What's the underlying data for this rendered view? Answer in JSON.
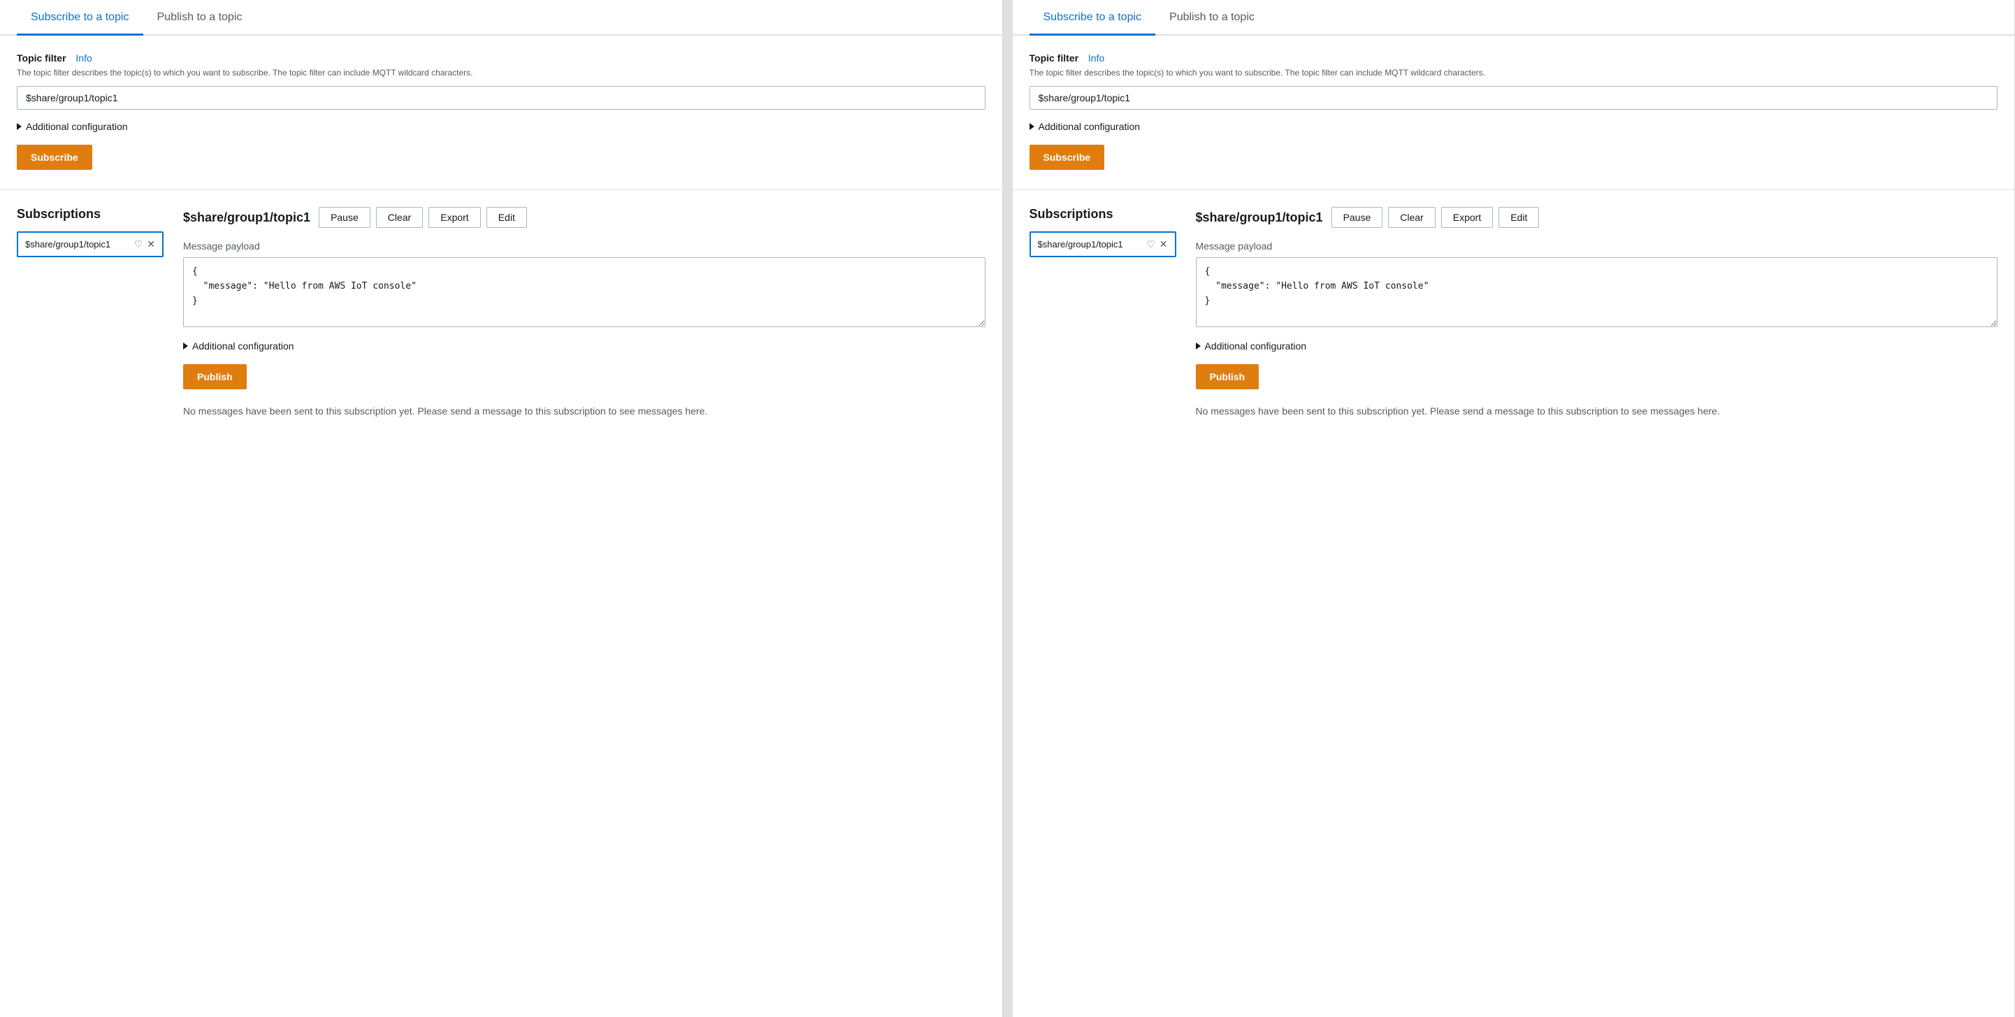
{
  "panels": [
    {
      "id": "left",
      "tabs": [
        {
          "label": "Subscribe to a topic",
          "active": true
        },
        {
          "label": "Publish to a topic",
          "active": false
        }
      ],
      "subscribe": {
        "field_label": "Topic filter",
        "info_label": "Info",
        "field_description": "The topic filter describes the topic(s) to which you want to subscribe. The topic filter can include MQTT wildcard characters.",
        "input_value": "$share/group1/topic1",
        "additional_config_label": "Additional configuration",
        "subscribe_btn_label": "Subscribe"
      },
      "subscriptions_title": "Subscriptions",
      "subscription_item": "$share/group1/topic1",
      "topic_title": "$share/group1/topic1",
      "topic_actions": {
        "pause": "Pause",
        "clear": "Clear",
        "export": "Export",
        "edit": "Edit"
      },
      "message_payload_label": "Message payload",
      "payload_text": "{\n  \"message\": \"Hello from AWS IoT console\"\n}",
      "additional_config_label": "Additional configuration",
      "publish_btn_label": "Publish",
      "no_messages_text": "No messages have been sent to this subscription yet. Please send a message to this subscription to see messages here."
    },
    {
      "id": "right",
      "tabs": [
        {
          "label": "Subscribe to a topic",
          "active": true
        },
        {
          "label": "Publish to a topic",
          "active": false
        }
      ],
      "subscribe": {
        "field_label": "Topic filter",
        "info_label": "Info",
        "field_description": "The topic filter describes the topic(s) to which you want to subscribe. The topic filter can include MQTT wildcard characters.",
        "input_value": "$share/group1/topic1",
        "additional_config_label": "Additional configuration",
        "subscribe_btn_label": "Subscribe"
      },
      "subscriptions_title": "Subscriptions",
      "subscription_item": "$share/group1/topic1",
      "topic_title": "$share/group1/topic1",
      "topic_actions": {
        "pause": "Pause",
        "clear": "Clear",
        "export": "Export",
        "edit": "Edit"
      },
      "message_payload_label": "Message payload",
      "payload_text": "{\n  \"message\": \"Hello from AWS IoT console\"\n}",
      "additional_config_label": "Additional configuration",
      "publish_btn_label": "Publish",
      "no_messages_text": "No messages have been sent to this subscription yet. Please send a message to this subscription to see messages here."
    }
  ]
}
